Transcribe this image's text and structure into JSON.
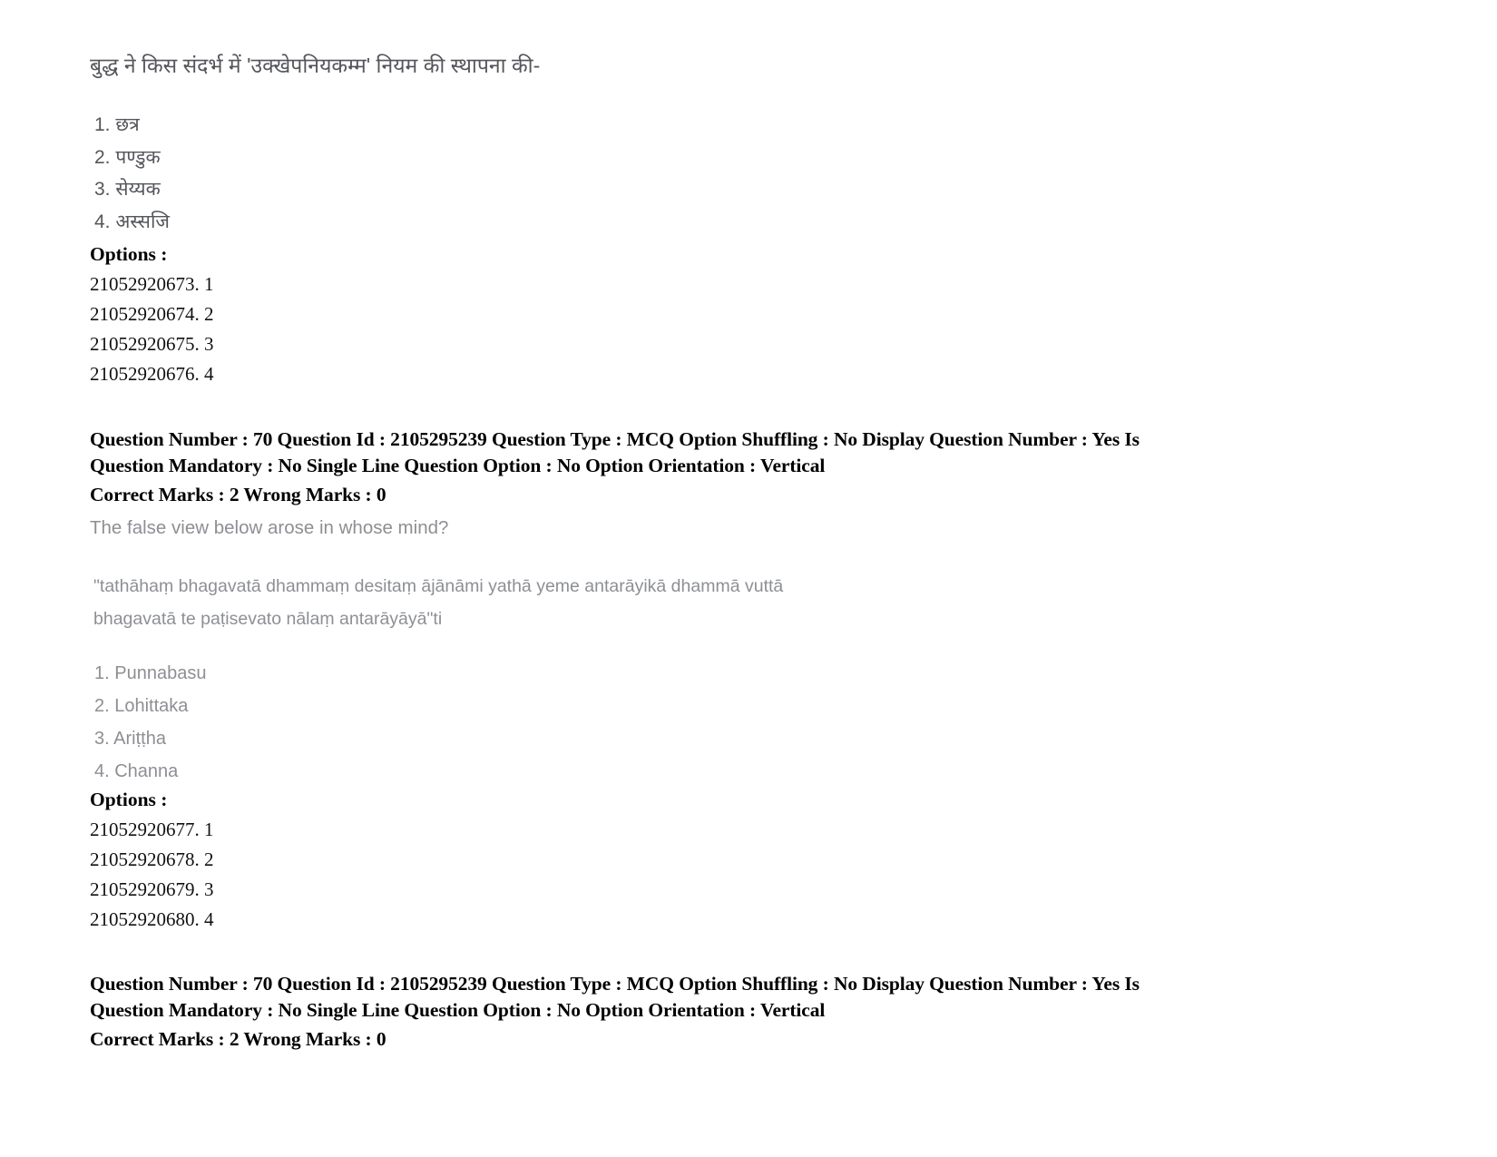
{
  "document": {
    "type": "scanned-exam-question-paper",
    "background_color": "#ffffff",
    "scan_text_color": "#54565b",
    "faded_text_color": "#8d8f94",
    "meta_text_color": "#000000"
  },
  "question_69": {
    "stem": "बुद्ध ने किस संदर्भ में 'उक्खेपनियकम्म' नियम की स्थापना की-",
    "choices": [
      "1. छत्र",
      "2. पण्डुक",
      "3. सेय्यक",
      "4. अस्सजि"
    ],
    "options_heading": "Options :",
    "option_ids": [
      "21052920673. 1",
      "21052920674. 2",
      "21052920675. 3",
      "21052920676. 4"
    ]
  },
  "meta_block_1": {
    "line1": "Question Number : 70 Question Id : 2105295239 Question Type : MCQ Option Shuffling : No Display Question Number : Yes Is",
    "line2": "Question Mandatory : No Single Line Question Option : No Option Orientation : Vertical",
    "line3": "Correct Marks : 2 Wrong Marks : 0",
    "fields": {
      "question_number": "70",
      "question_id": "2105295239",
      "question_type": "MCQ",
      "option_shuffling": "No",
      "display_question_number": "Yes",
      "is_question_mandatory": "No",
      "single_line_question_option": "No",
      "option_orientation": "Vertical",
      "correct_marks": "2",
      "wrong_marks": "0"
    }
  },
  "question_70": {
    "stem": "The false view below arose in whose mind?",
    "quote_line1": "\"tathāhaṃ bhagavatā dhammaṃ desitaṃ ājānāmi yathā yeme antarāyikā dhammā vuttā",
    "quote_line2": "bhagavatā te paṭisevato nālaṃ antarāyāyā\"ti",
    "choices": [
      "1. Punnabasu",
      "2. Lohittaka",
      "3. Ariṭṭha",
      "4. Channa"
    ],
    "options_heading": "Options :",
    "option_ids": [
      "21052920677. 1",
      "21052920678. 2",
      "21052920679. 3",
      "21052920680. 4"
    ]
  },
  "meta_block_2": {
    "line1": "Question Number : 70 Question Id : 2105295239 Question Type : MCQ Option Shuffling : No Display Question Number : Yes Is",
    "line2": "Question Mandatory : No Single Line Question Option : No Option Orientation : Vertical",
    "line3": "Correct Marks : 2 Wrong Marks : 0",
    "fields": {
      "question_number": "70",
      "question_id": "2105295239",
      "question_type": "MCQ",
      "option_shuffling": "No",
      "display_question_number": "Yes",
      "is_question_mandatory": "No",
      "single_line_question_option": "No",
      "option_orientation": "Vertical",
      "correct_marks": "2",
      "wrong_marks": "0"
    }
  }
}
